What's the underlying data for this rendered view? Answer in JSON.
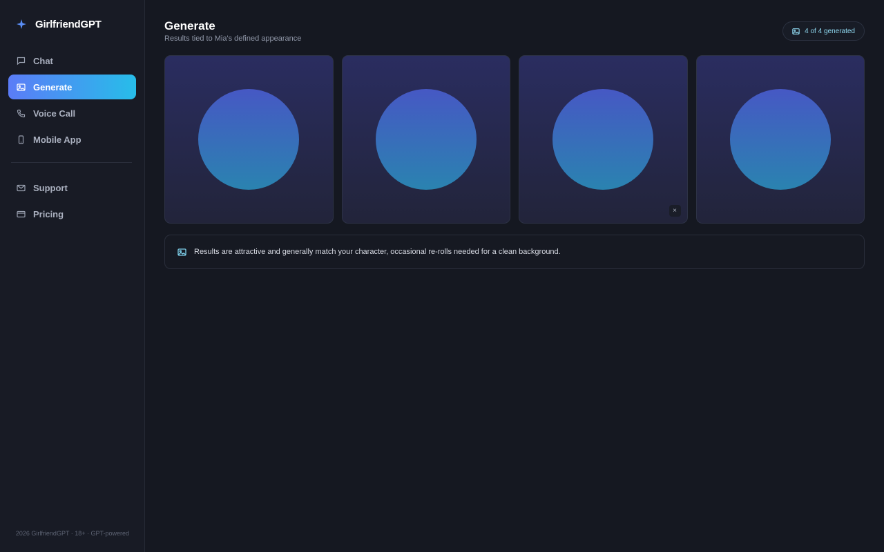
{
  "brand": {
    "name": "GirlfriendGPT"
  },
  "sidebar": {
    "items": [
      {
        "label": "Chat",
        "icon": "chat-bubble-icon",
        "active": false
      },
      {
        "label": "Generate",
        "icon": "image-icon",
        "active": true
      },
      {
        "label": "Voice Call",
        "icon": "phone-icon",
        "active": false
      },
      {
        "label": "Mobile App",
        "icon": "mobile-icon",
        "active": false
      }
    ],
    "secondary_items": [
      {
        "label": "Support",
        "icon": "mail-icon"
      },
      {
        "label": "Pricing",
        "icon": "credit-card-icon"
      }
    ],
    "footer": "2026 GirlfriendGPT · 18+ · GPT-powered"
  },
  "page": {
    "title": "Generate",
    "subtitle": "Results tied to Mia's defined appearance",
    "badge": "4 of 4 generated"
  },
  "results": {
    "count": 4,
    "close_label": "×"
  },
  "notice": {
    "text": "Results are attractive and generally match your character, occasional re-rolls needed for a clean background."
  },
  "colors": {
    "accent_start": "#5b7cf7",
    "accent_end": "#27bde9",
    "background": "#151821",
    "sidebar": "#181b25"
  }
}
